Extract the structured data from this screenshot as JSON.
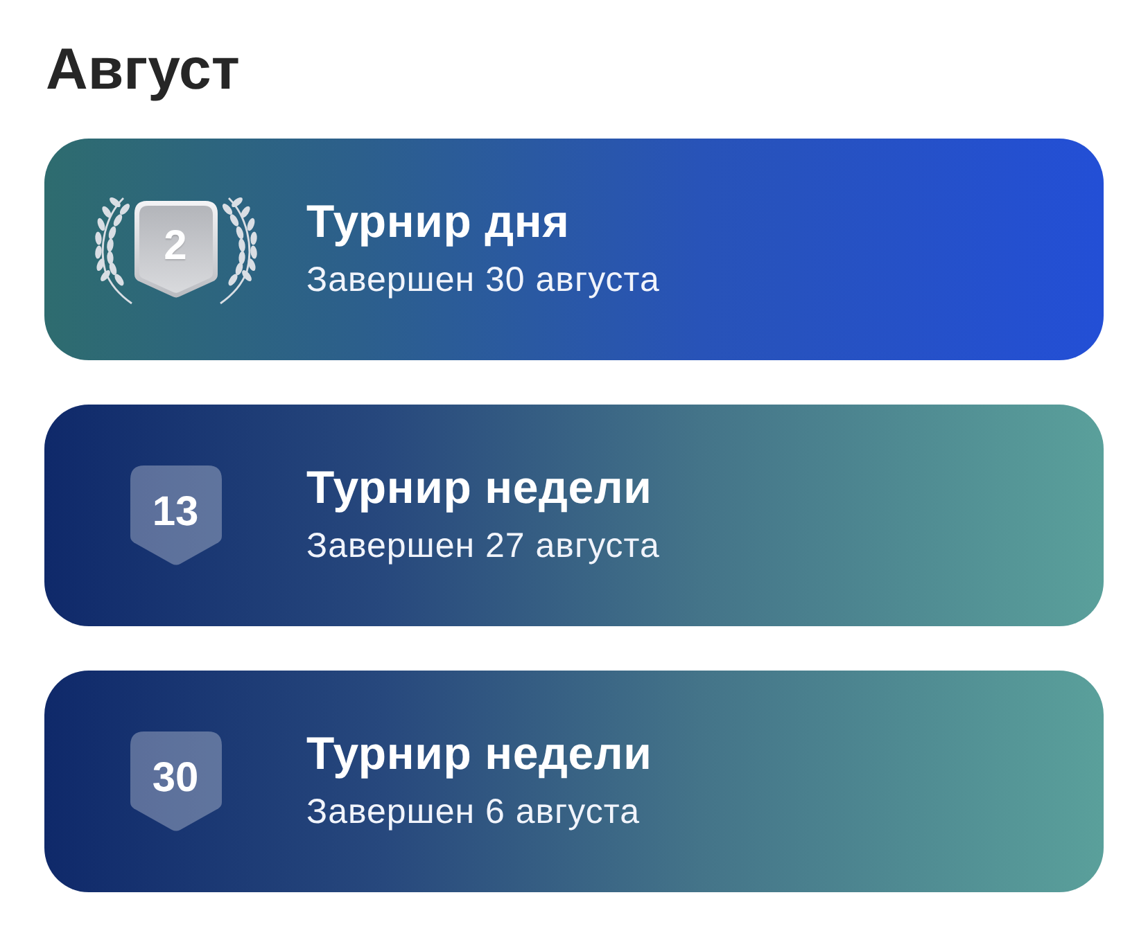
{
  "month": {
    "title": "Август"
  },
  "tournaments": [
    {
      "kind": "medal",
      "place": "2",
      "title": "Турнир дня",
      "status": "Завершен 30 августа"
    },
    {
      "kind": "rank",
      "place": "13",
      "title": "Турнир недели",
      "status": "Завершен 27 августа"
    },
    {
      "kind": "rank",
      "place": "30",
      "title": "Турнир недели",
      "status": "Завершен 6 августа"
    }
  ]
}
